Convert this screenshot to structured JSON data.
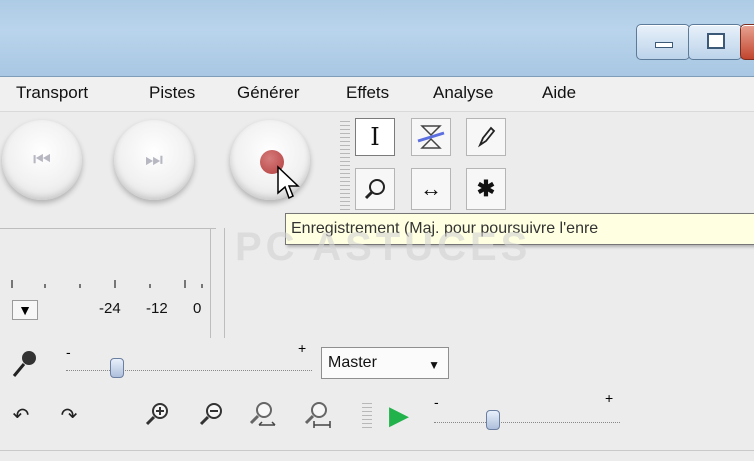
{
  "menu": {
    "items": [
      "Transport",
      "Pistes",
      "Générer",
      "Effets",
      "Analyse",
      "Aide"
    ]
  },
  "toolbar": {
    "transport": {
      "skip_start_icon": "skip-start-icon",
      "skip_end_icon": "skip-end-icon",
      "record_icon": "record-icon"
    },
    "tools": {
      "selection": "I",
      "envelope": "envelope-icon",
      "draw": "draw-icon",
      "zoom": "zoom-icon",
      "timeshift": "↔",
      "multi": "✱"
    },
    "tooltip": "Enregistrement (Maj. pour poursuivre l'enre",
    "meter": {
      "ticks": [
        "-24",
        "-12",
        "0"
      ]
    },
    "watermark": "PC ASTUCES"
  },
  "mixer": {
    "minus": "-",
    "plus": "+",
    "input_select": "Master"
  },
  "edit_toolbar": {
    "undo": "↶",
    "redo": "↷",
    "play_icon": "play-icon"
  },
  "colors": {
    "record_red": "#b43f3f",
    "play_green": "#22b24c",
    "tooltip_bg": "#ffffe1"
  }
}
